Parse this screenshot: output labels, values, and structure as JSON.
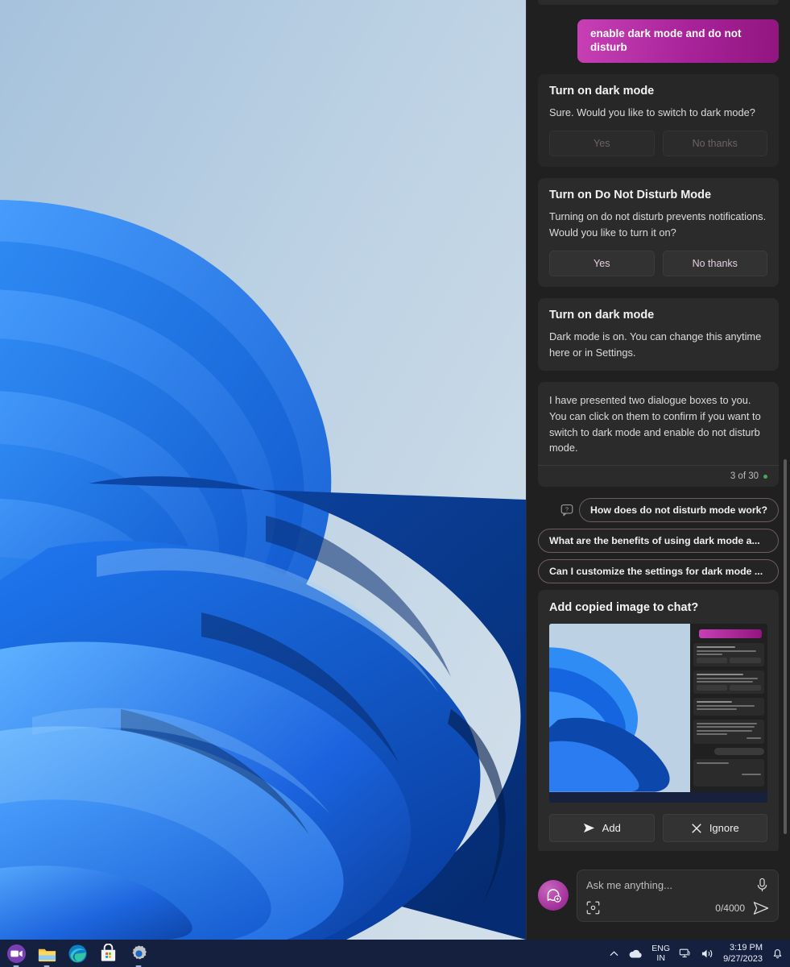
{
  "chat": {
    "user_message": "enable dark mode and do not disturb",
    "cards": [
      {
        "title": "Turn on dark mode",
        "body": "Sure. Would you like to switch to dark mode?",
        "yes_label": "Yes",
        "no_label": "No thanks",
        "state": "disabled"
      },
      {
        "title": "Turn on Do Not Disturb Mode",
        "body": "Turning on do not disturb prevents notifications. Would you like to turn it on?",
        "yes_label": "Yes",
        "no_label": "No thanks",
        "state": "active"
      },
      {
        "title": "Turn on dark mode",
        "body": "Dark mode is on. You can change this anytime here or in Settings.",
        "state": "info"
      }
    ],
    "summary_message": {
      "text": "I have presented two dialogue boxes to you. You can click on them to confirm if you want to switch to dark mode and enable do not disturb mode.",
      "counter": "3 of 30"
    },
    "suggestions": [
      "How does do not disturb mode work?",
      "What are the benefits of using dark mode a...",
      "Can I customize the settings for dark mode ..."
    ],
    "image_panel": {
      "title": "Add copied image to chat?",
      "add_label": "Add",
      "ignore_label": "Ignore"
    },
    "composer": {
      "placeholder": "Ask me anything...",
      "value": "",
      "counter": "0/4000"
    },
    "accent_color": "#a8239a",
    "panel_bg": "#202020",
    "card_bg": "#2b2b2b"
  },
  "taskbar": {
    "apps": [
      "chat-app-icon",
      "file-explorer-icon",
      "edge-browser-icon",
      "microsoft-store-icon",
      "settings-icon"
    ],
    "tray": {
      "language_primary": "ENG",
      "language_secondary": "IN",
      "time": "3:19 PM",
      "date": "9/27/2023"
    }
  }
}
